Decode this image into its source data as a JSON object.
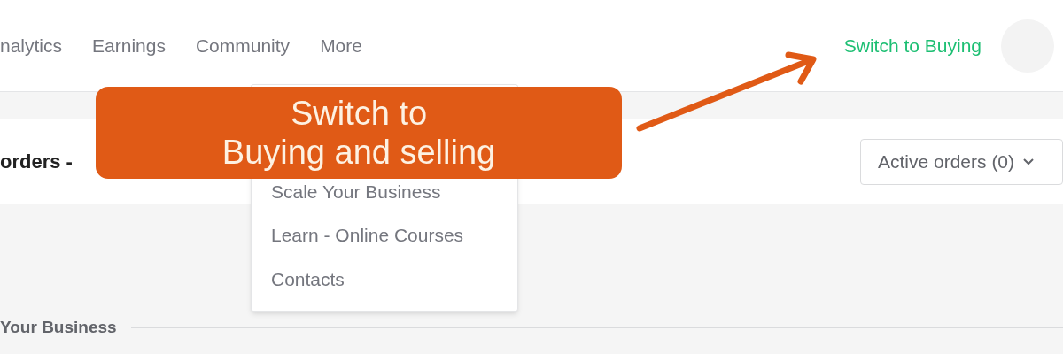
{
  "nav": {
    "items": [
      {
        "label": "nalytics"
      },
      {
        "label": "Earnings"
      },
      {
        "label": "Community"
      },
      {
        "label": "More"
      }
    ],
    "switch_link": "Switch to Buying"
  },
  "orders_card": {
    "title": "orders -",
    "filter": "Active orders (0)"
  },
  "section": {
    "title": "Your Business"
  },
  "more_menu": {
    "items": [
      "Scale Your Business",
      "Learn - Online Courses",
      "Contacts"
    ]
  },
  "callout": {
    "lines": [
      "Switch to",
      "Buying and selling"
    ]
  }
}
